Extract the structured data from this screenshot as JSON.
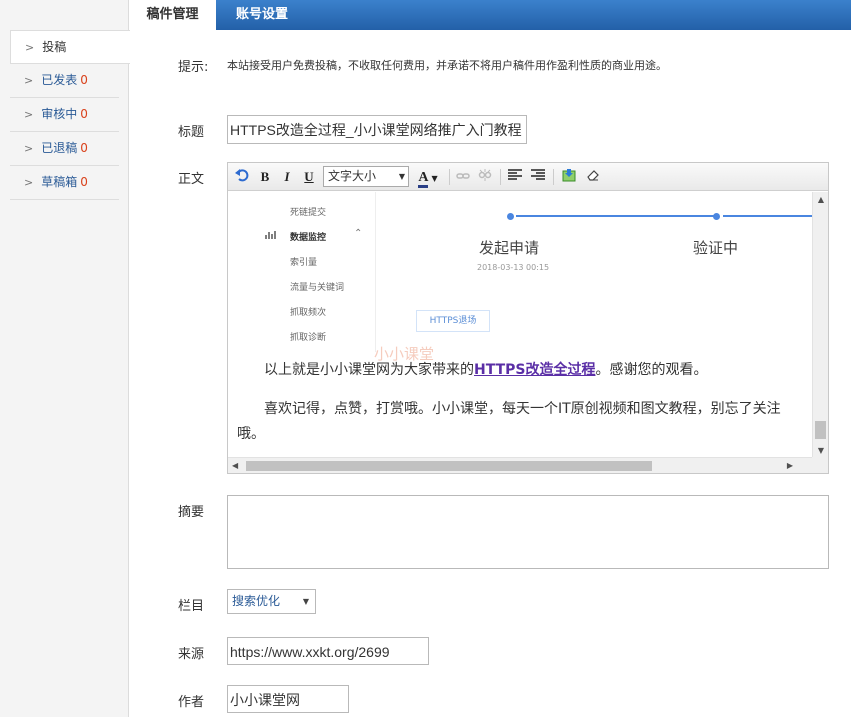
{
  "tabs": [
    {
      "label": "稿件管理",
      "active": true
    },
    {
      "label": "账号设置",
      "active": false
    }
  ],
  "sidebar": {
    "items": [
      {
        "arrow": ">",
        "label": "投稿",
        "count": ""
      },
      {
        "arrow": ">",
        "label": "已发表",
        "count": "0"
      },
      {
        "arrow": ">",
        "label": "审核中",
        "count": "0"
      },
      {
        "arrow": ">",
        "label": "已退稿",
        "count": "0"
      },
      {
        "arrow": ">",
        "label": "草稿箱",
        "count": "0"
      }
    ]
  },
  "form": {
    "tip_label": "提示:",
    "tip_text": "本站接受用户免费投稿，不收取任何费用，并承诺不将用户稿件用作盈利性质的商业用途。",
    "title_label": "标题",
    "title_value": "HTTPS改造全过程_小小课堂网络推广入门教程",
    "body_label": "正文",
    "summary_label": "摘要",
    "summary_value": "",
    "category_label": "栏目",
    "category_value": "搜索优化",
    "source_label": "来源",
    "source_value": "https://www.xxkt.org/2699",
    "author_label": "作者",
    "author_value": "小小课堂网"
  },
  "editor": {
    "toolbar": {
      "bold": "B",
      "italic": "I",
      "underline": "U",
      "font_size": "文字大小",
      "font_color": "A"
    },
    "embedded": {
      "menu": [
        "死链提交",
        "数据监控",
        "索引量",
        "流量与关键词",
        "抓取频次",
        "抓取诊断"
      ],
      "step1_title": "发起申请",
      "step1_date": "2018-03-13 00:15",
      "step2_title": "验证中",
      "button": "HTTPS退场",
      "watermark": "小小课堂"
    },
    "para1_before": "以上就是小小课堂网为大家带来的",
    "para1_link": "HTTPS改造全过程",
    "para1_after": "。感谢您的观看。",
    "para2": "喜欢记得，点赞，打赏哦。小小课堂，每天一个IT原创视频和图文教程，别忘了关注哦。"
  }
}
